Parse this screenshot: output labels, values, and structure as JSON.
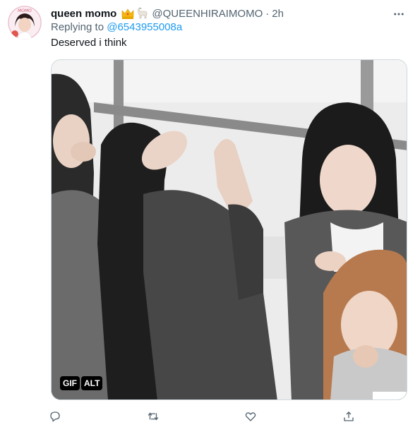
{
  "tweet": {
    "display_name": "queen momo",
    "name_emojis": [
      "crown-emoji",
      "goat-emoji"
    ],
    "handle": "@QUEENHIRAIMOMO",
    "separator": "·",
    "time": "2h",
    "reply_prefix": "Replying to",
    "reply_to": "@6543955008a",
    "text": "Deserved i think",
    "avatar_label": "MOMO",
    "media": {
      "type": "gif",
      "badges": [
        "GIF",
        "ALT"
      ]
    },
    "actions": [
      "reply-icon",
      "retweet-icon",
      "like-icon",
      "share-icon"
    ]
  },
  "colors": {
    "text": "#0f1419",
    "secondary": "#536471",
    "link": "#1d9bf0",
    "border": "#cfd9de"
  }
}
